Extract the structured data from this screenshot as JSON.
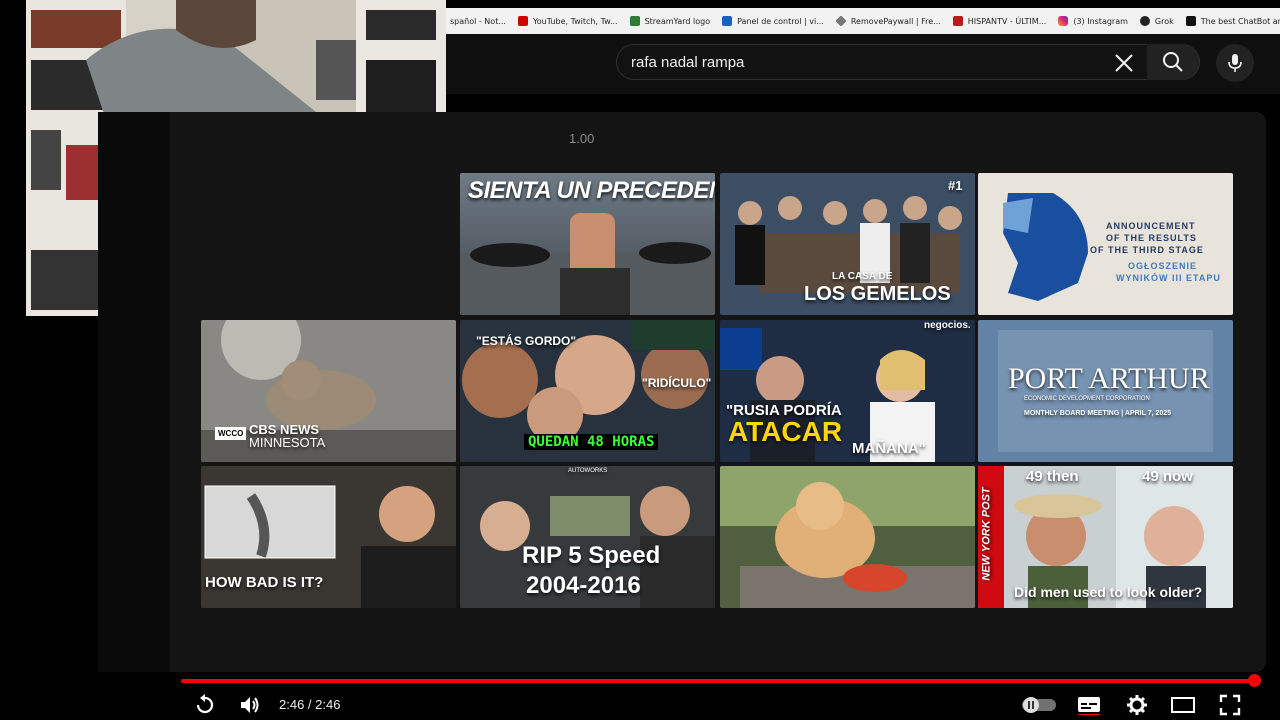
{
  "bookmarks": [
    {
      "label": "spañol - Not...",
      "icon": "notion-icon",
      "color": "#888888"
    },
    {
      "label": "YouTube, Twitch, Tw...",
      "icon": "youtube-icon",
      "color": "#cc0000"
    },
    {
      "label": "StreamYard logo",
      "icon": "streamyard-icon",
      "color": "#2e7d32"
    },
    {
      "label": "Panel de control | vi...",
      "icon": "dashboard-icon",
      "color": "#1565c0"
    },
    {
      "label": "RemovePaywall | Fre...",
      "icon": "diamond-icon",
      "color": "#777777"
    },
    {
      "label": "HISPANTV - ÚLTIM...",
      "icon": "hispantv-icon",
      "color": "#b71c1c"
    },
    {
      "label": "(3) Instagram",
      "icon": "instagram-icon",
      "color": "#e1306c"
    },
    {
      "label": "Grok",
      "icon": "grok-icon",
      "color": "#222222"
    },
    {
      "label": "The best ChatBot an...",
      "icon": "chatbot-icon",
      "color": "#111111"
    }
  ],
  "search": {
    "value": "rafa nadal rampa"
  },
  "speed_label": "1.00",
  "thumbnails": [
    {
      "caption": "SIENTA UN PRECEDENTE"
    },
    {
      "caption": "LA CASA DE",
      "caption2": "LOS GEMELOS",
      "badge": "#1"
    },
    {
      "caption": "ANNOUNCEMENT",
      "caption2": "OF THE RESULTS",
      "caption3": "OF THE THIRD STAGE",
      "caption4": "OGŁOSZENIE",
      "caption5": "WYNIKÓW III ETAPU"
    },
    {
      "caption": "CBS NEWS",
      "caption2": "MINNESOTA",
      "caption3": "WCCO"
    },
    {
      "caption": "\"ESTÁS GORDO\"",
      "caption2": "\"RIDÍCULO\"",
      "caption3": "QUEDAN 48 HORAS"
    },
    {
      "caption": "negocios.",
      "caption2": "\"RUSIA PODRÍA",
      "caption3": "ATACAR",
      "caption4": "MAÑANA\""
    },
    {
      "caption": "PORT ARTHUR",
      "caption2": "ECONOMIC DEVELOPMENT CORPORATION",
      "caption3": "MONTHLY BOARD MEETING | APRIL 7, 2025"
    },
    {
      "caption": "HOW BAD IS IT?"
    },
    {
      "caption": "RIP 5 Speed",
      "caption2": "2004-2016",
      "caption3": "AUTOWORKS"
    },
    {
      "caption": ""
    },
    {
      "caption": "49 then",
      "caption2": "49 now",
      "caption3": "NEW YORK POST",
      "caption4": "Did men used to look older?"
    }
  ],
  "player": {
    "time": "2:46 / 2:46",
    "progress": 1.0,
    "accent": "#ff0000"
  }
}
